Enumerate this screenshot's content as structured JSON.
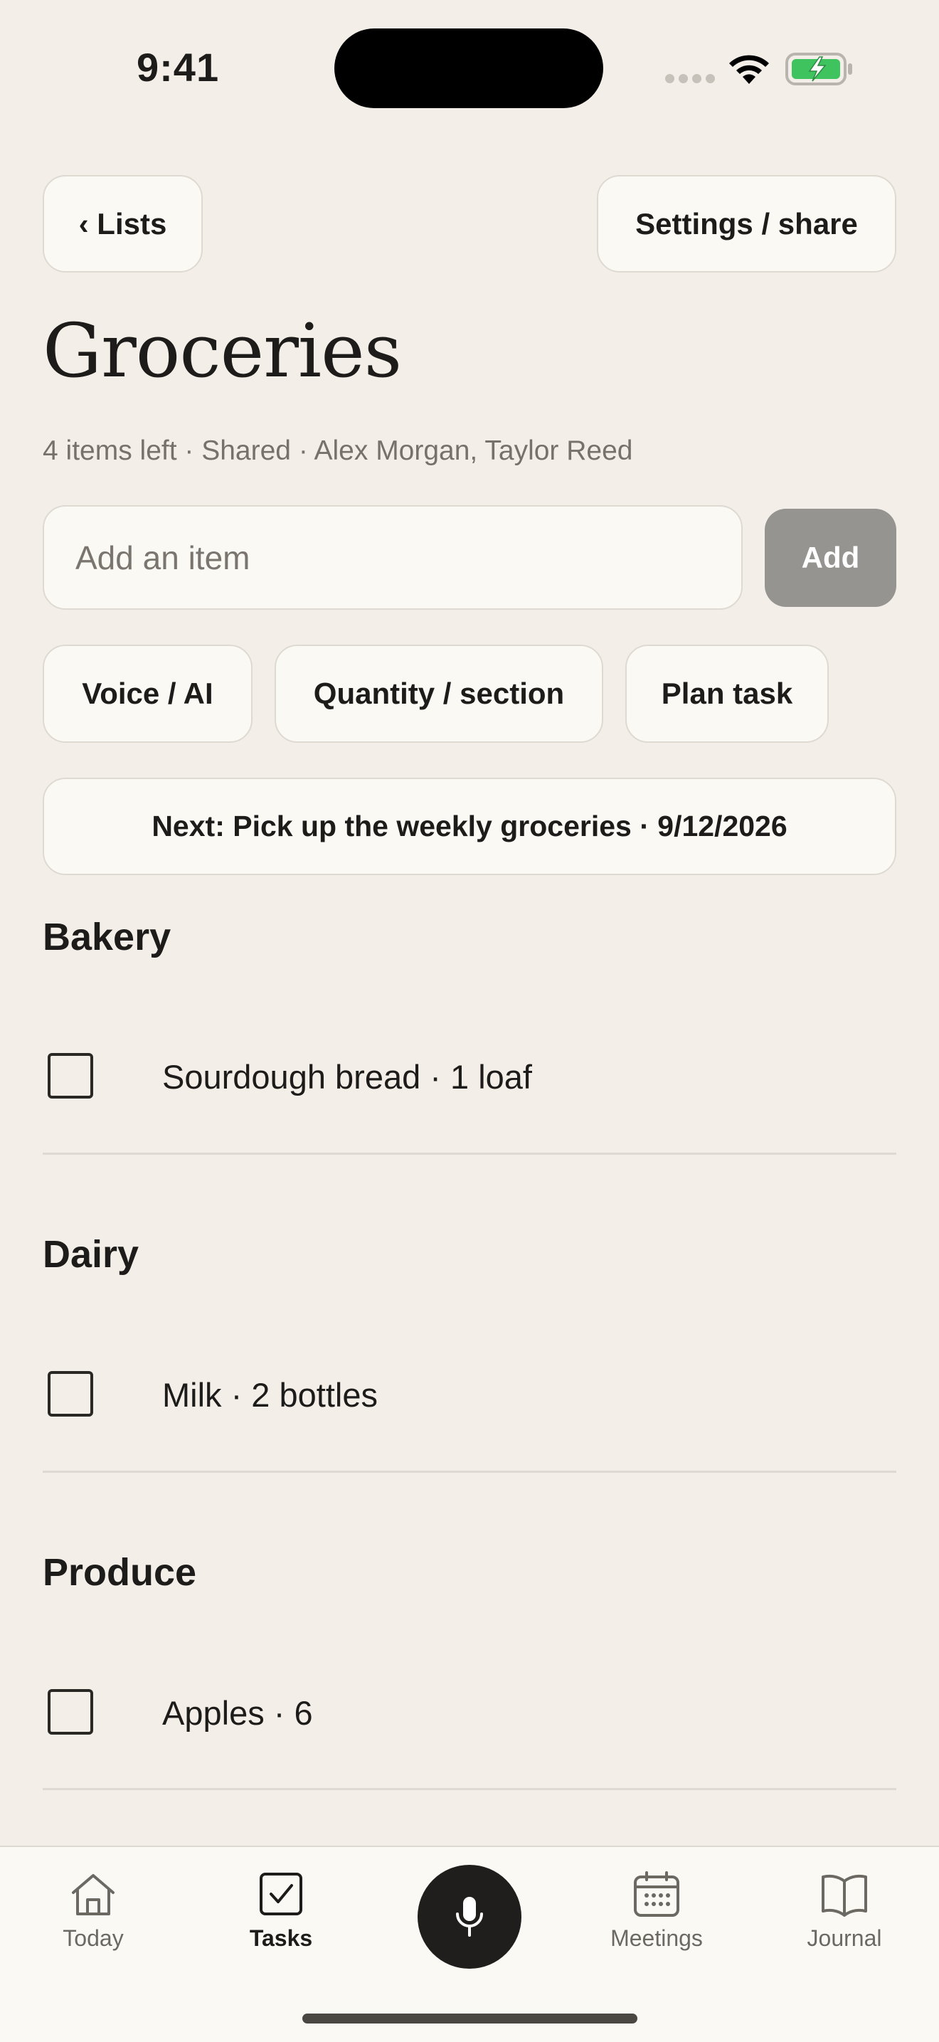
{
  "status_bar": {
    "time": "9:41"
  },
  "header": {
    "back_label": "‹ Lists",
    "settings_label": "Settings / share"
  },
  "list": {
    "title": "Groceries",
    "meta": "4 items left · Shared · Alex Morgan, Taylor Reed"
  },
  "add_item": {
    "placeholder": "Add an item",
    "value": "",
    "button_label": "Add"
  },
  "chips": [
    {
      "label": "Voice / AI"
    },
    {
      "label": "Quantity / section"
    },
    {
      "label": "Plan task"
    }
  ],
  "next_banner": "Next: Pick up the weekly groceries · 9/12/2026",
  "sections": [
    {
      "title": "Bakery",
      "items": [
        {
          "label": "Sourdough bread · 1 loaf",
          "checked": false
        }
      ]
    },
    {
      "title": "Dairy",
      "items": [
        {
          "label": "Milk · 2 bottles",
          "checked": false
        }
      ]
    },
    {
      "title": "Produce",
      "items": [
        {
          "label": "Apples · 6",
          "checked": false
        }
      ]
    }
  ],
  "tab_bar": {
    "tabs": [
      {
        "label": "Today",
        "icon": "home-icon",
        "active": false
      },
      {
        "label": "Tasks",
        "icon": "check-square-icon",
        "active": true
      },
      {
        "label": "Meetings",
        "icon": "calendar-icon",
        "active": false
      },
      {
        "label": "Journal",
        "icon": "book-icon",
        "active": false
      }
    ],
    "center_button_icon": "microphone-icon"
  },
  "colors": {
    "background": "#f3efe8",
    "surface": "#fbf9f4",
    "border": "#dedad2",
    "text": "#1d1c1a",
    "muted_text": "#76716a",
    "add_button_disabled": "#969490",
    "battery_green": "#3fc35f"
  }
}
